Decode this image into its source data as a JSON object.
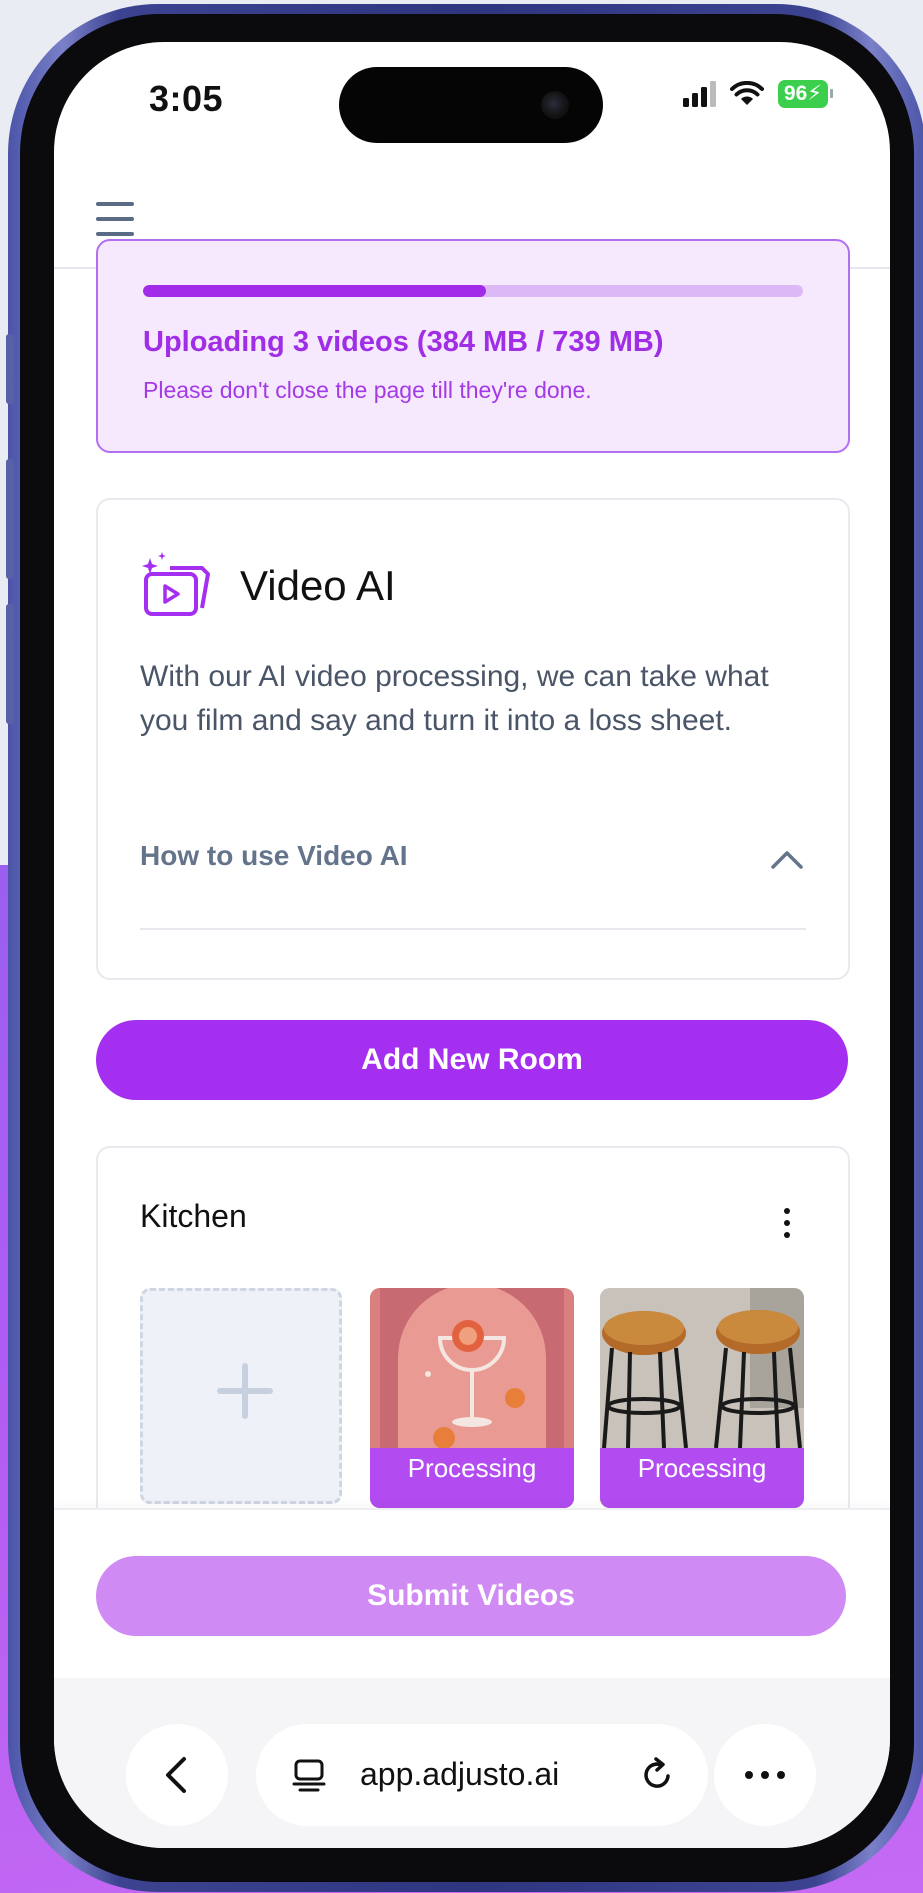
{
  "status_bar": {
    "time": "3:05",
    "battery": "96"
  },
  "upload_banner": {
    "progress": 0.52,
    "title": "Uploading 3 videos (384 MB / 739 MB)",
    "subtitle": "Please don't close the page till they're done."
  },
  "video_ai": {
    "icon": "video-sparkle-icon",
    "title": "Video AI",
    "description": "With our AI video processing, we can take what you film and say and turn it into a loss sheet.",
    "how_to_label": "How to use Video AI"
  },
  "add_room_label": "Add New Room",
  "room": {
    "title": "Kitchen",
    "videos": [
      {
        "status": "Processing"
      },
      {
        "status": "Processing"
      }
    ]
  },
  "submit_label": "Submit Videos",
  "browser": {
    "url": "app.adjusto.ai"
  },
  "colors": {
    "accent": "#a52ff0",
    "banner_bg": "#f6e8fd",
    "submit_disabled": "#cf8af4"
  }
}
